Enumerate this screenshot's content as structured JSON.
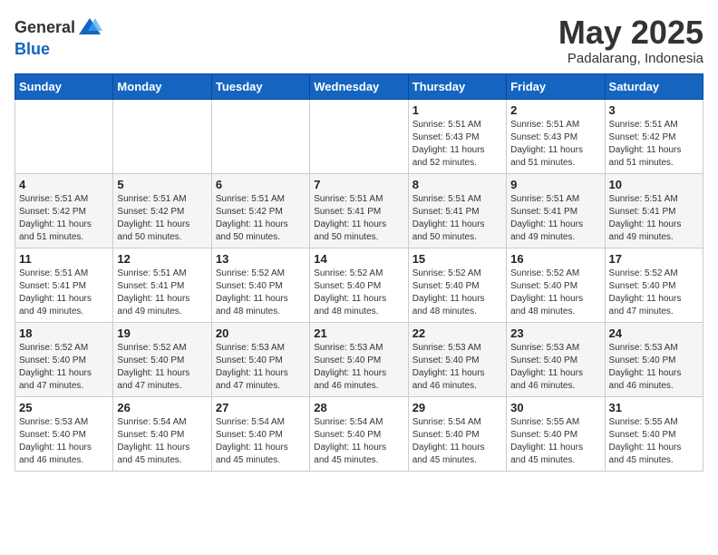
{
  "header": {
    "logo_general": "General",
    "logo_blue": "Blue",
    "month_year": "May 2025",
    "location": "Padalarang, Indonesia"
  },
  "weekdays": [
    "Sunday",
    "Monday",
    "Tuesday",
    "Wednesday",
    "Thursday",
    "Friday",
    "Saturday"
  ],
  "weeks": [
    [
      {
        "day": "",
        "info": ""
      },
      {
        "day": "",
        "info": ""
      },
      {
        "day": "",
        "info": ""
      },
      {
        "day": "",
        "info": ""
      },
      {
        "day": "1",
        "info": "Sunrise: 5:51 AM\nSunset: 5:43 PM\nDaylight: 11 hours\nand 52 minutes."
      },
      {
        "day": "2",
        "info": "Sunrise: 5:51 AM\nSunset: 5:43 PM\nDaylight: 11 hours\nand 51 minutes."
      },
      {
        "day": "3",
        "info": "Sunrise: 5:51 AM\nSunset: 5:42 PM\nDaylight: 11 hours\nand 51 minutes."
      }
    ],
    [
      {
        "day": "4",
        "info": "Sunrise: 5:51 AM\nSunset: 5:42 PM\nDaylight: 11 hours\nand 51 minutes."
      },
      {
        "day": "5",
        "info": "Sunrise: 5:51 AM\nSunset: 5:42 PM\nDaylight: 11 hours\nand 50 minutes."
      },
      {
        "day": "6",
        "info": "Sunrise: 5:51 AM\nSunset: 5:42 PM\nDaylight: 11 hours\nand 50 minutes."
      },
      {
        "day": "7",
        "info": "Sunrise: 5:51 AM\nSunset: 5:41 PM\nDaylight: 11 hours\nand 50 minutes."
      },
      {
        "day": "8",
        "info": "Sunrise: 5:51 AM\nSunset: 5:41 PM\nDaylight: 11 hours\nand 50 minutes."
      },
      {
        "day": "9",
        "info": "Sunrise: 5:51 AM\nSunset: 5:41 PM\nDaylight: 11 hours\nand 49 minutes."
      },
      {
        "day": "10",
        "info": "Sunrise: 5:51 AM\nSunset: 5:41 PM\nDaylight: 11 hours\nand 49 minutes."
      }
    ],
    [
      {
        "day": "11",
        "info": "Sunrise: 5:51 AM\nSunset: 5:41 PM\nDaylight: 11 hours\nand 49 minutes."
      },
      {
        "day": "12",
        "info": "Sunrise: 5:51 AM\nSunset: 5:41 PM\nDaylight: 11 hours\nand 49 minutes."
      },
      {
        "day": "13",
        "info": "Sunrise: 5:52 AM\nSunset: 5:40 PM\nDaylight: 11 hours\nand 48 minutes."
      },
      {
        "day": "14",
        "info": "Sunrise: 5:52 AM\nSunset: 5:40 PM\nDaylight: 11 hours\nand 48 minutes."
      },
      {
        "day": "15",
        "info": "Sunrise: 5:52 AM\nSunset: 5:40 PM\nDaylight: 11 hours\nand 48 minutes."
      },
      {
        "day": "16",
        "info": "Sunrise: 5:52 AM\nSunset: 5:40 PM\nDaylight: 11 hours\nand 48 minutes."
      },
      {
        "day": "17",
        "info": "Sunrise: 5:52 AM\nSunset: 5:40 PM\nDaylight: 11 hours\nand 47 minutes."
      }
    ],
    [
      {
        "day": "18",
        "info": "Sunrise: 5:52 AM\nSunset: 5:40 PM\nDaylight: 11 hours\nand 47 minutes."
      },
      {
        "day": "19",
        "info": "Sunrise: 5:52 AM\nSunset: 5:40 PM\nDaylight: 11 hours\nand 47 minutes."
      },
      {
        "day": "20",
        "info": "Sunrise: 5:53 AM\nSunset: 5:40 PM\nDaylight: 11 hours\nand 47 minutes."
      },
      {
        "day": "21",
        "info": "Sunrise: 5:53 AM\nSunset: 5:40 PM\nDaylight: 11 hours\nand 46 minutes."
      },
      {
        "day": "22",
        "info": "Sunrise: 5:53 AM\nSunset: 5:40 PM\nDaylight: 11 hours\nand 46 minutes."
      },
      {
        "day": "23",
        "info": "Sunrise: 5:53 AM\nSunset: 5:40 PM\nDaylight: 11 hours\nand 46 minutes."
      },
      {
        "day": "24",
        "info": "Sunrise: 5:53 AM\nSunset: 5:40 PM\nDaylight: 11 hours\nand 46 minutes."
      }
    ],
    [
      {
        "day": "25",
        "info": "Sunrise: 5:53 AM\nSunset: 5:40 PM\nDaylight: 11 hours\nand 46 minutes."
      },
      {
        "day": "26",
        "info": "Sunrise: 5:54 AM\nSunset: 5:40 PM\nDaylight: 11 hours\nand 45 minutes."
      },
      {
        "day": "27",
        "info": "Sunrise: 5:54 AM\nSunset: 5:40 PM\nDaylight: 11 hours\nand 45 minutes."
      },
      {
        "day": "28",
        "info": "Sunrise: 5:54 AM\nSunset: 5:40 PM\nDaylight: 11 hours\nand 45 minutes."
      },
      {
        "day": "29",
        "info": "Sunrise: 5:54 AM\nSunset: 5:40 PM\nDaylight: 11 hours\nand 45 minutes."
      },
      {
        "day": "30",
        "info": "Sunrise: 5:55 AM\nSunset: 5:40 PM\nDaylight: 11 hours\nand 45 minutes."
      },
      {
        "day": "31",
        "info": "Sunrise: 5:55 AM\nSunset: 5:40 PM\nDaylight: 11 hours\nand 45 minutes."
      }
    ]
  ]
}
